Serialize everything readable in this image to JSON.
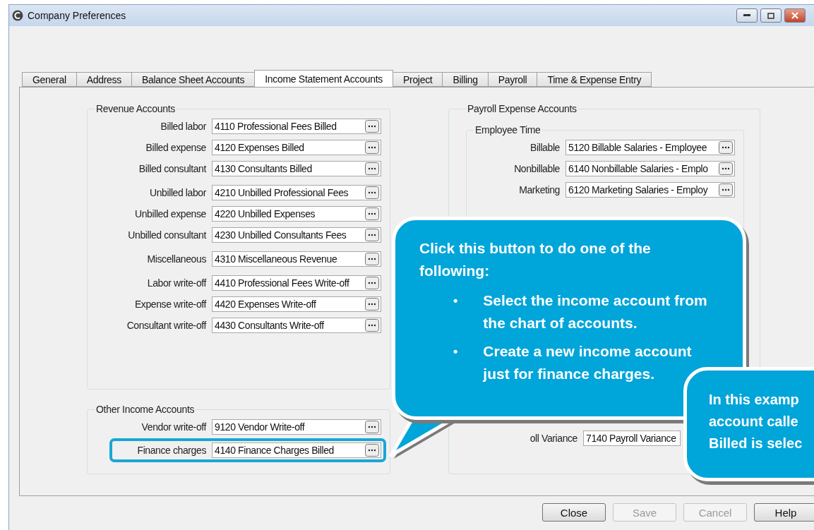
{
  "window": {
    "title": "Company Preferences"
  },
  "tabs": [
    {
      "label": "General",
      "selected": false
    },
    {
      "label": "Address",
      "selected": false
    },
    {
      "label": "Balance Sheet Accounts",
      "selected": false
    },
    {
      "label": "Income Statement Accounts",
      "selected": true
    },
    {
      "label": "Project",
      "selected": false
    },
    {
      "label": "Billing",
      "selected": false
    },
    {
      "label": "Payroll",
      "selected": false
    },
    {
      "label": "Time & Expense Entry",
      "selected": false
    }
  ],
  "revenue_accounts": {
    "title": "Revenue Accounts",
    "sections": [
      [
        {
          "label": "Billed labor",
          "value": "4110 Professional Fees Billed"
        },
        {
          "label": "Billed expense",
          "value": "4120 Expenses Billed"
        },
        {
          "label": "Billed consultant",
          "value": "4130 Consultants Billed"
        }
      ],
      [
        {
          "label": "Unbilled labor",
          "value": "4210 Unbilled Professional Fees"
        },
        {
          "label": "Unbilled expense",
          "value": "4220 Unbilled Expenses"
        },
        {
          "label": "Unbilled consultant",
          "value": "4230 Unbilled Consultants Fees"
        }
      ],
      [
        {
          "label": "Miscellaneous",
          "value": "4310 Miscellaneous Revenue"
        }
      ],
      [
        {
          "label": "Labor write-off",
          "value": "4410 Professional Fees Write-off"
        },
        {
          "label": "Expense write-off",
          "value": "4420 Expenses Write-off"
        },
        {
          "label": "Consultant write-off",
          "value": "4430 Consultants Write-off"
        }
      ]
    ]
  },
  "other_income_accounts": {
    "title": "Other Income Accounts",
    "rows": [
      {
        "label": "Vendor write-off",
        "value": "9120 Vendor Write-off",
        "highlighted": false
      },
      {
        "label": "Finance charges",
        "value": "4140 Finance Charges Billed",
        "highlighted": true
      }
    ]
  },
  "payroll_expense_accounts": {
    "title": "Payroll Expense Accounts",
    "employee_time": {
      "title": "Employee Time",
      "rows": [
        {
          "label": "Billable",
          "value": "5120 Billable Salaries - Employee"
        },
        {
          "label": "Nonbillable",
          "value": "6140 Nonbillable Salaries - Emplo"
        },
        {
          "label": "Marketing",
          "value": "6120 Marketing Salaries - Employ"
        }
      ]
    },
    "variance": {
      "label": "oll Variance",
      "value": "7140 Payroll Variance"
    }
  },
  "buttons": [
    {
      "label": "Close",
      "disabled": false
    },
    {
      "label": "Save",
      "disabled": true
    },
    {
      "label": "Cancel",
      "disabled": true
    },
    {
      "label": "Help",
      "disabled": false
    }
  ],
  "callouts": [
    {
      "intro": "Click this button to do one of the following:",
      "bullet_mark": "•",
      "bullets": [
        "Select the income account from the chart of accounts.",
        "Create a new income account just for finance charges."
      ]
    },
    {
      "lines": [
        "In this examp",
        "account calle",
        "Billed is selec"
      ]
    }
  ]
}
